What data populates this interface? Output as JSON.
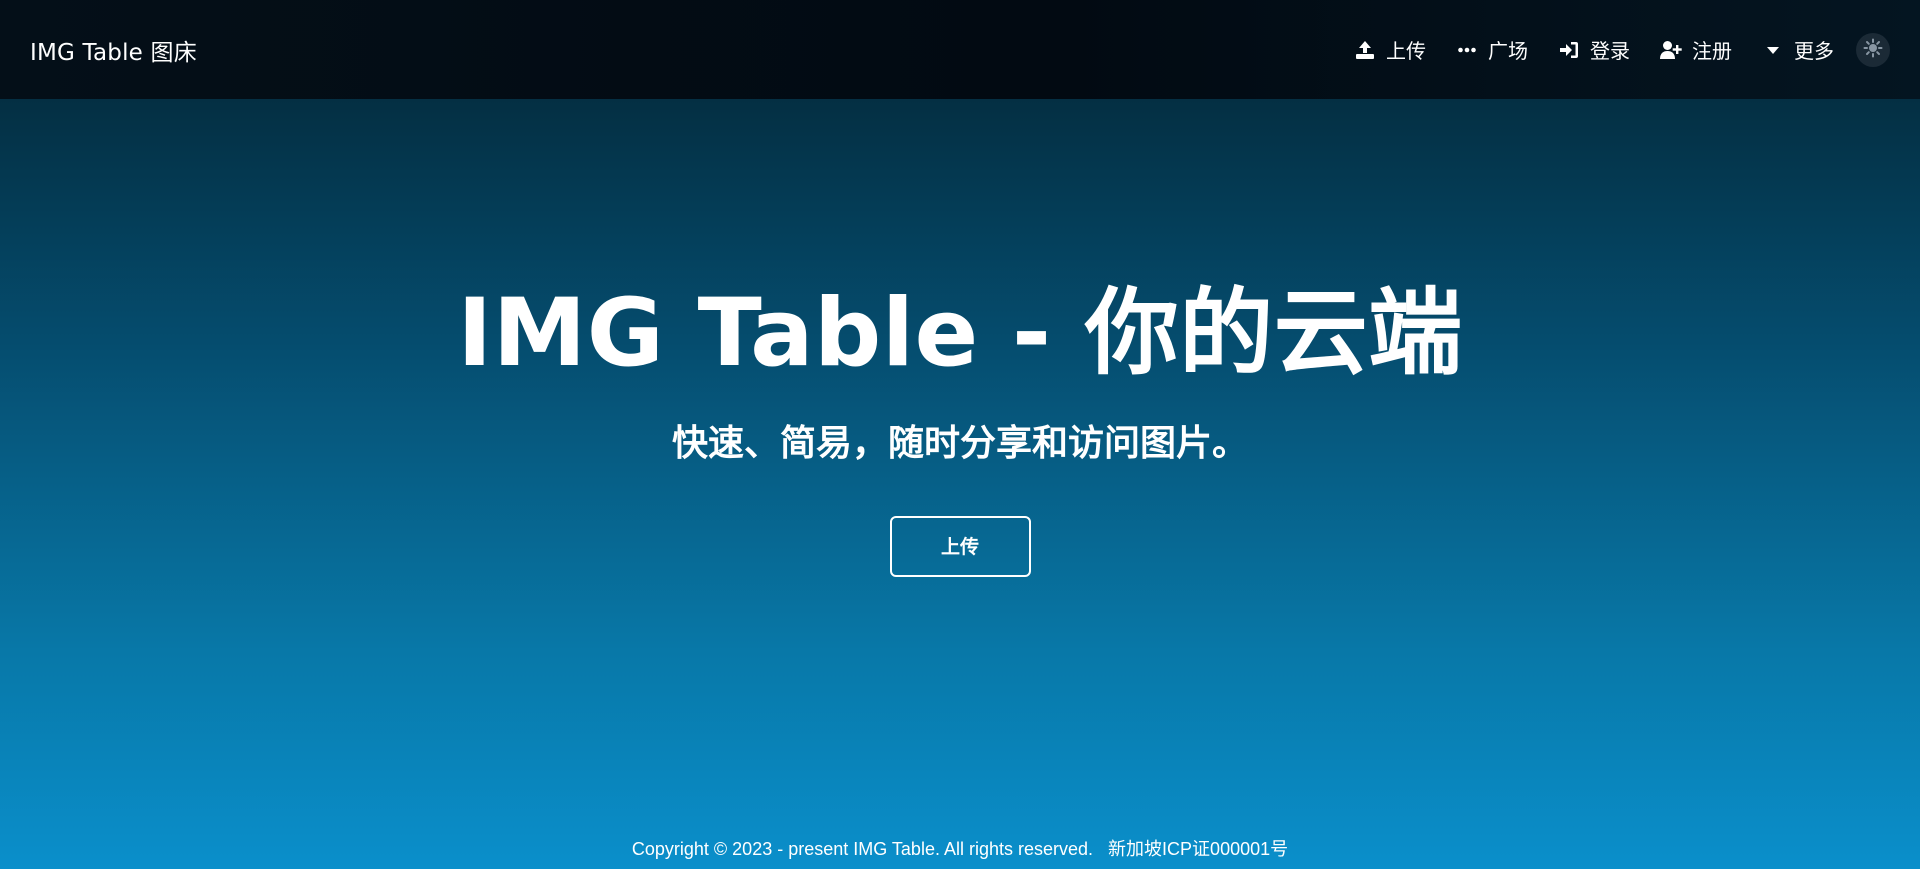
{
  "navbar": {
    "brand": "IMG Table 图床",
    "items": [
      {
        "label": "上传",
        "icon": "upload-icon"
      },
      {
        "label": "广场",
        "icon": "ellipsis-icon"
      },
      {
        "label": "登录",
        "icon": "sign-in-icon"
      },
      {
        "label": "注册",
        "icon": "user-plus-icon"
      },
      {
        "label": "更多",
        "icon": "caret-down-icon"
      }
    ],
    "theme_toggle_icon": "sun-icon"
  },
  "hero": {
    "title": "IMG Table - 你的云端",
    "subtitle": "快速、简易，随时分享和访问图片。",
    "upload_button": "上传"
  },
  "footer": {
    "copyright": "Copyright © 2023 - present IMG Table. All rights reserved.",
    "icp": "新加坡ICP证000001号"
  },
  "colors": {
    "navbar_bg": "#030c14",
    "gradient_top": "#032331",
    "gradient_bottom": "#0a8fcb",
    "text": "#ffffff",
    "toggle_bg": "#1b2a36"
  }
}
